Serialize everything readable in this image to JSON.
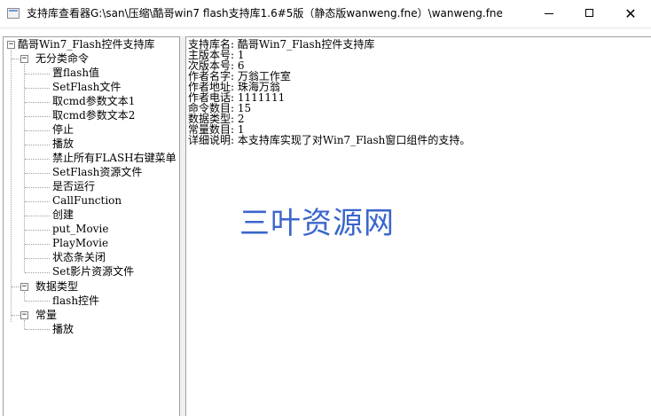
{
  "window": {
    "title": "支持库查看器G:\\san\\压缩\\酷哥win7 flash支持库1.6#5版（静态版wanweng.fne）\\wanweng.fne",
    "minimize_glyph": "",
    "maximize_glyph": "",
    "close_glyph": "✕"
  },
  "tree": {
    "root": {
      "label": "酷哥Win7_Flash控件支持库",
      "expander": "−"
    },
    "groups": [
      {
        "label": "无分类命令",
        "expander": "−",
        "items": [
          "置flash值",
          "SetFlash文件",
          "取cmd参数文本1",
          "取cmd参数文本2",
          "停止",
          "播放",
          "禁止所有FLASH右键菜单",
          "SetFlash资源文件",
          "是否运行",
          "CallFunction",
          "创建",
          "put_Movie",
          "PlayMovie",
          "状态条关闭",
          "Set影片资源文件"
        ]
      },
      {
        "label": "数据类型",
        "expander": "−",
        "items": [
          "flash控件"
        ]
      },
      {
        "label": "常量",
        "expander": "−",
        "items": [
          "播放"
        ]
      }
    ]
  },
  "details": {
    "lines": [
      "支持库名: 酷哥Win7_Flash控件支持库",
      "主版本号: 1",
      "次版本号: 6",
      "作者名字: 万翁工作室",
      "作者地址: 珠海万翁",
      "作者电话: 1111111",
      "命令数目: 15",
      "数据类型: 2",
      "常量数目: 1",
      "详细说明: 本支持库实现了对Win7_Flash窗口组件的支持。"
    ]
  },
  "watermark": "三叶资源网",
  "colors": {
    "watermark": "#3a66cc",
    "pane_border": "#a0a0a0",
    "splitter": "#f0f0f0"
  }
}
